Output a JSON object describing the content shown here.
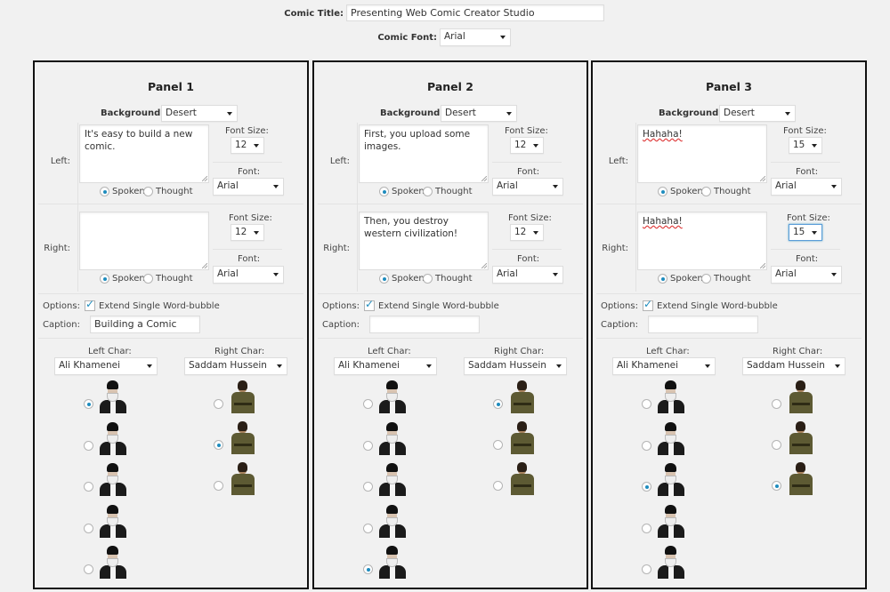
{
  "header": {
    "title_label": "Comic Title:",
    "title_value": "Presenting Web Comic Creator Studio",
    "font_label": "Comic Font:",
    "font_value": "Arial"
  },
  "labels": {
    "background": "Background:",
    "font_size": "Font Size:",
    "font": "Font:",
    "left": "Left:",
    "right": "Right:",
    "spoken": "Spoken",
    "thought": "Thought",
    "options": "Options:",
    "extend": "Extend Single Word-bubble",
    "caption": "Caption:",
    "left_char": "Left Char:",
    "right_char": "Right Char:"
  },
  "panels": [
    {
      "title": "Panel 1",
      "background": "Desert",
      "left": {
        "text": "It's easy to build a new comic.",
        "font_size": "12",
        "font": "Arial",
        "mode": "spoken"
      },
      "right": {
        "text": "",
        "font_size": "12",
        "font": "Arial",
        "mode": "spoken"
      },
      "extend_checked": true,
      "caption": "Building a Comic",
      "left_char": "Ali Khamenei",
      "right_char": "Saddam Hussein",
      "left_selected": 0,
      "right_selected": 1
    },
    {
      "title": "Panel 2",
      "background": "Desert",
      "left": {
        "text": "First, you upload some images.",
        "font_size": "12",
        "font": "Arial",
        "mode": "spoken"
      },
      "right": {
        "text": "Then, you destroy western civilization!",
        "font_size": "12",
        "font": "Arial",
        "mode": "spoken"
      },
      "extend_checked": true,
      "caption": "",
      "left_char": "Ali Khamenei",
      "right_char": "Saddam Hussein",
      "left_selected": 4,
      "right_selected": 0
    },
    {
      "title": "Panel 3",
      "background": "Desert",
      "left": {
        "text": "Hahaha!",
        "font_size": "15",
        "font": "Arial",
        "mode": "spoken"
      },
      "right": {
        "text": "Hahaha!",
        "font_size": "15",
        "font": "Arial",
        "mode": "spoken"
      },
      "extend_checked": true,
      "caption": "",
      "left_char": "Ali Khamenei",
      "right_char": "Saddam Hussein",
      "left_selected": 2,
      "right_selected": 2
    }
  ],
  "colors": {
    "accent": "#1e8cbe",
    "border": "#111111",
    "background": "#f1f1f1"
  }
}
